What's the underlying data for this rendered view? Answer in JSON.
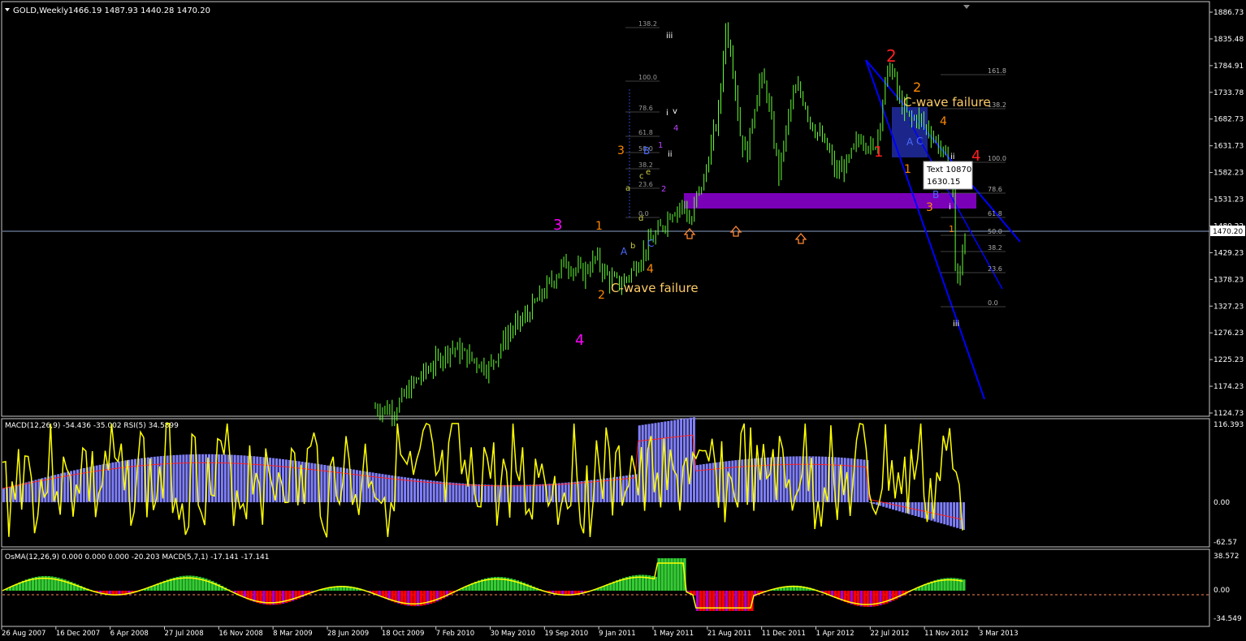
{
  "window": {
    "symbol_label": "GOLD,Weekly",
    "ohlc_label": "1466.19 1487.93 1440.28 1470.20",
    "current_price": "1470.20"
  },
  "colors": {
    "background": "#000000",
    "candle": "#66ff33",
    "frame": "#ffffff",
    "macd_hist": "#8080ff",
    "signal": "#ff2020",
    "rsi": "#ffff00",
    "osma_pos": "#33cc33",
    "osma_neg": "#ff0000",
    "osma_dark": "#aa00cc",
    "trend": "#0000ff",
    "zone": "#7a00b8",
    "box": "#1f2a99"
  },
  "chart_data": [
    {
      "type": "candlestick",
      "title": "GOLD,Weekly",
      "price_axis_labels": [
        "1886.73",
        "1835.48",
        "1784.91",
        "1733.78",
        "1682.73",
        "1631.73",
        "1582.23",
        "1531.23",
        "1480.22",
        "1429.23",
        "1378.23",
        "1327.23",
        "1276.23",
        "1225.23",
        "1174.23",
        "1124.73"
      ],
      "ylim": [
        1124.73,
        1886.73
      ],
      "time_axis_labels": [
        "26 Aug 2007",
        "16 Dec 2007",
        "6 Apr 2008",
        "27 Jul 2008",
        "16 Nov 2008",
        "8 Mar 2009",
        "28 Jun 2009",
        "18 Oct 2009",
        "7 Feb 2010",
        "30 May 2010",
        "19 Sep 2010",
        "9 Jan 2011",
        "1 May 2011",
        "21 Aug 2011",
        "11 Dec 2011",
        "1 Apr 2012",
        "22 Jul 2012",
        "11 Nov 2012",
        "3 Mar 2013"
      ],
      "close_path": [
        [
          0.0,
          1135
        ],
        [
          0.03,
          1130
        ],
        [
          0.06,
          1180
        ],
        [
          0.09,
          1215
        ],
        [
          0.12,
          1250
        ],
        [
          0.15,
          1230
        ],
        [
          0.18,
          1210
        ],
        [
          0.21,
          1275
        ],
        [
          0.24,
          1310
        ],
        [
          0.27,
          1360
        ],
        [
          0.3,
          1410
        ],
        [
          0.33,
          1390
        ],
        [
          0.35,
          1420
        ],
        [
          0.37,
          1380
        ],
        [
          0.39,
          1370
        ],
        [
          0.41,
          1400
        ],
        [
          0.43,
          1440
        ],
        [
          0.45,
          1470
        ],
        [
          0.47,
          1510
        ],
        [
          0.49,
          1520
        ],
        [
          0.5,
          1480
        ],
        [
          0.51,
          1540
        ],
        [
          0.52,
          1560
        ],
        [
          0.53,
          1620
        ],
        [
          0.545,
          1700
        ],
        [
          0.555,
          1860
        ],
        [
          0.565,
          1810
        ],
        [
          0.58,
          1640
        ],
        [
          0.59,
          1620
        ],
        [
          0.6,
          1700
        ],
        [
          0.61,
          1760
        ],
        [
          0.62,
          1740
        ],
        [
          0.63,
          1660
        ],
        [
          0.64,
          1580
        ],
        [
          0.65,
          1650
        ],
        [
          0.66,
          1720
        ],
        [
          0.67,
          1740
        ],
        [
          0.68,
          1720
        ],
        [
          0.69,
          1680
        ],
        [
          0.7,
          1660
        ],
        [
          0.71,
          1640
        ],
        [
          0.72,
          1620
        ],
        [
          0.73,
          1580
        ],
        [
          0.74,
          1590
        ],
        [
          0.75,
          1600
        ],
        [
          0.76,
          1630
        ],
        [
          0.77,
          1650
        ],
        [
          0.78,
          1640
        ],
        [
          0.79,
          1620
        ],
        [
          0.8,
          1680
        ],
        [
          0.81,
          1760
        ],
        [
          0.815,
          1780
        ],
        [
          0.82,
          1775
        ],
        [
          0.83,
          1720
        ],
        [
          0.84,
          1700
        ],
        [
          0.85,
          1680
        ],
        [
          0.86,
          1690
        ],
        [
          0.87,
          1670
        ],
        [
          0.88,
          1660
        ],
        [
          0.89,
          1640
        ],
        [
          0.9,
          1620
        ],
        [
          0.905,
          1600
        ],
        [
          0.91,
          1590
        ],
        [
          0.915,
          1560
        ],
        [
          0.92,
          1400
        ],
        [
          0.925,
          1360
        ],
        [
          0.93,
          1420
        ],
        [
          0.935,
          1470
        ]
      ],
      "wave_labels": [
        {
          "text": "3",
          "color": "#ff00ff"
        },
        {
          "text": "4",
          "color": "#ff00ff"
        },
        {
          "text": "1",
          "color": "#ff8800"
        },
        {
          "text": "2",
          "color": "#ff8800"
        },
        {
          "text": "3",
          "color": "#ff8800"
        },
        {
          "text": "4",
          "color": "#ff8800"
        },
        {
          "text": "C-wave failure",
          "color": "#ffcc66"
        },
        {
          "text": "A",
          "color": "#4a6bff"
        },
        {
          "text": "b",
          "color": "#cccc44"
        },
        {
          "text": "B",
          "color": "#4a6bff"
        },
        {
          "text": "C",
          "color": "#4a6bff"
        },
        {
          "text": "a",
          "color": "#cccc44"
        },
        {
          "text": "c",
          "color": "#cccc44"
        },
        {
          "text": "d",
          "color": "#cccc44"
        },
        {
          "text": "e",
          "color": "#cccc44"
        },
        {
          "text": "1",
          "color": "#bb44ff"
        },
        {
          "text": "2",
          "color": "#bb44ff"
        },
        {
          "text": "4",
          "color": "#bb44ff"
        },
        {
          "text": "iii",
          "color": "#ffffff"
        },
        {
          "text": "i",
          "color": "#ffffff"
        },
        {
          "text": "v",
          "color": "#ffffff"
        },
        {
          "text": "ii",
          "color": "#ffffff"
        },
        {
          "text": "2",
          "color": "#ff2020"
        },
        {
          "text": "1",
          "color": "#ff2020"
        },
        {
          "text": "4",
          "color": "#ff2020"
        },
        {
          "text": "2",
          "color": "#ff8800"
        },
        {
          "text": "4",
          "color": "#ff8800"
        },
        {
          "text": "1",
          "color": "#ff8800"
        },
        {
          "text": "3",
          "color": "#ff8800"
        },
        {
          "text": "C-wave failure",
          "color": "#ffcc66"
        },
        {
          "text": "A",
          "color": "#4a6bff"
        },
        {
          "text": "C",
          "color": "#4a6bff"
        },
        {
          "text": "B",
          "color": "#4a6bff"
        },
        {
          "text": "ii",
          "color": "#ffffff"
        },
        {
          "text": "i",
          "color": "#ffffff"
        },
        {
          "text": "iii",
          "color": "#ffffff"
        },
        {
          "text": "1",
          "color": "#ff8800"
        }
      ],
      "fib_left": [
        "138.2",
        "100.0",
        "78.6",
        "61.8",
        "50.0",
        "38.2",
        "23.6",
        "0.0"
      ],
      "fib_right": [
        "161.8",
        "138.2",
        "100.0",
        "78.6",
        "61.8",
        "50.0",
        "38.2",
        "23.6",
        "0.0"
      ],
      "tooltip": {
        "line1": "Text 10870",
        "line2": "1630.15"
      }
    },
    {
      "type": "bar",
      "title": "MACD(12,26,9) -54.436 -35.002  RSI(5) 34.5899",
      "axis_labels": [
        "116.393",
        "0.00",
        "-62.57"
      ],
      "ylim": [
        -62.57,
        116.393
      ]
    },
    {
      "type": "bar",
      "title": "OsMA(12,26,9) 0.000 0.000 0.000 -20.203  MACD(5,7,1) -17.141 -17.141",
      "axis_labels": [
        "38.572",
        "0.00",
        "-34.549"
      ],
      "ylim": [
        -34.549,
        38.572
      ]
    }
  ]
}
